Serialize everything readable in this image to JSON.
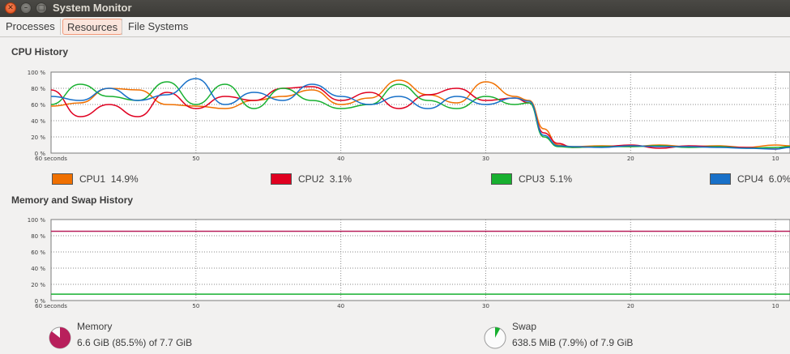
{
  "window": {
    "title": "System Monitor"
  },
  "tabs": [
    {
      "label": "Processes",
      "active": false
    },
    {
      "label": "Resources",
      "active": true
    },
    {
      "label": "File Systems",
      "active": false
    }
  ],
  "cpu": {
    "title": "CPU History",
    "legend": [
      {
        "name": "CPU1",
        "value": "14.9%",
        "color": "#f07000"
      },
      {
        "name": "CPU2",
        "value": "3.1%",
        "color": "#e00020"
      },
      {
        "name": "CPU3",
        "value": "5.1%",
        "color": "#18b030"
      },
      {
        "name": "CPU4",
        "value": "6.0%",
        "color": "#1870c8"
      }
    ]
  },
  "memory": {
    "title": "Memory and Swap History",
    "memory_label": "Memory",
    "memory_value": "6.6 GiB (85.5%) of 7.7 GiB",
    "memory_color": "#b8205c",
    "swap_label": "Swap",
    "swap_value": "638.5 MiB (7.9%) of 7.9 GiB",
    "swap_color": "#18b030"
  },
  "chart_data": [
    {
      "type": "line",
      "title": "CPU History",
      "y_tick_labels": [
        "0 %",
        "20 %",
        "40 %",
        "60 %",
        "80 %",
        "100 %"
      ],
      "x_tick_labels": [
        "60 seconds",
        "50",
        "40",
        "30",
        "20",
        "10"
      ],
      "ylim": [
        0,
        100
      ],
      "xlim": [
        60,
        9
      ],
      "grid": true,
      "x": [
        60,
        58,
        56,
        54,
        52,
        50,
        48,
        46,
        44,
        42,
        40,
        38,
        36,
        34,
        32,
        30,
        28,
        27,
        26,
        25,
        24,
        22,
        20,
        18,
        16,
        14,
        12,
        10,
        9
      ],
      "series": [
        {
          "name": "CPU1",
          "color": "#f07000",
          "values": [
            58,
            62,
            80,
            78,
            60,
            58,
            55,
            65,
            70,
            78,
            60,
            68,
            90,
            72,
            62,
            88,
            70,
            65,
            30,
            10,
            8,
            9,
            8,
            10,
            8,
            9,
            7,
            10,
            9
          ]
        },
        {
          "name": "CPU2",
          "color": "#e00020",
          "values": [
            78,
            45,
            60,
            45,
            75,
            55,
            70,
            65,
            80,
            82,
            65,
            75,
            55,
            72,
            80,
            65,
            68,
            62,
            25,
            12,
            7,
            8,
            10,
            6,
            9,
            8,
            7,
            5,
            8
          ]
        },
        {
          "name": "CPU3",
          "color": "#18b030",
          "values": [
            60,
            85,
            70,
            65,
            88,
            60,
            85,
            55,
            80,
            65,
            55,
            60,
            85,
            65,
            55,
            70,
            60,
            62,
            20,
            8,
            7,
            8,
            8,
            9,
            7,
            8,
            6,
            7,
            8
          ]
        },
        {
          "name": "CPU4",
          "color": "#1870c8",
          "values": [
            70,
            65,
            80,
            65,
            72,
            92,
            60,
            75,
            65,
            85,
            70,
            60,
            70,
            55,
            70,
            60,
            68,
            64,
            22,
            9,
            8,
            7,
            9,
            8,
            8,
            7,
            6,
            5,
            7
          ]
        }
      ]
    },
    {
      "type": "line",
      "title": "Memory and Swap History",
      "y_tick_labels": [
        "0 %",
        "20 %",
        "40 %",
        "60 %",
        "80 %",
        "100 %"
      ],
      "x_tick_labels": [
        "60 seconds",
        "50",
        "40",
        "30",
        "20",
        "10"
      ],
      "ylim": [
        0,
        100
      ],
      "xlim": [
        60,
        9
      ],
      "grid": true,
      "x": [
        60,
        9
      ],
      "series": [
        {
          "name": "Memory",
          "color": "#b8205c",
          "values": [
            85.5,
            85.5
          ]
        },
        {
          "name": "Swap",
          "color": "#18b030",
          "values": [
            7.9,
            7.9
          ]
        }
      ]
    }
  ]
}
